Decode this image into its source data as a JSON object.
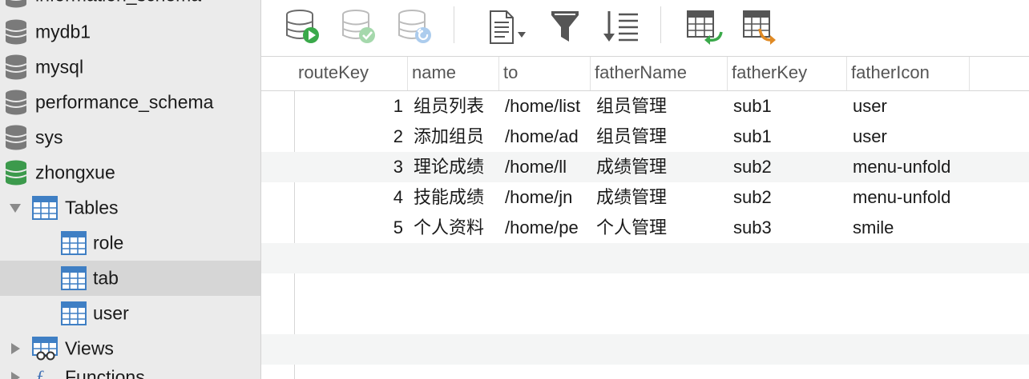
{
  "sidebar": {
    "items": [
      {
        "label": "information_schema",
        "kind": "database",
        "color": "#7a7a7a"
      },
      {
        "label": "mydb1",
        "kind": "database",
        "color": "#7a7a7a"
      },
      {
        "label": "mysql",
        "kind": "database",
        "color": "#7a7a7a"
      },
      {
        "label": "performance_schema",
        "kind": "database",
        "color": "#7a7a7a"
      },
      {
        "label": "sys",
        "kind": "database",
        "color": "#7a7a7a"
      },
      {
        "label": "zhongxue",
        "kind": "database",
        "color": "#3c9a4c"
      },
      {
        "label": "Tables",
        "kind": "group",
        "expanded": true
      },
      {
        "label": "role",
        "kind": "table"
      },
      {
        "label": "tab",
        "kind": "table",
        "selected": true
      },
      {
        "label": "user",
        "kind": "table"
      },
      {
        "label": "Views",
        "kind": "group",
        "expanded": false
      },
      {
        "label": "Functions",
        "kind": "group",
        "expanded": false
      }
    ]
  },
  "toolbar": {
    "buttons": [
      {
        "name": "run-query-button",
        "icon": "database-run-icon",
        "enabled": true
      },
      {
        "name": "apply-button",
        "icon": "database-check-icon",
        "enabled": false
      },
      {
        "name": "discard-button",
        "icon": "database-revert-icon",
        "enabled": false
      },
      {
        "name": "export-menu-button",
        "icon": "document-dropdown-icon",
        "enabled": true
      },
      {
        "name": "filter-button",
        "icon": "filter-icon",
        "enabled": true
      },
      {
        "name": "sort-button",
        "icon": "sort-icon",
        "enabled": true
      },
      {
        "name": "import-button",
        "icon": "table-import-icon",
        "enabled": true
      },
      {
        "name": "export-button",
        "icon": "table-export-icon",
        "enabled": true
      }
    ]
  },
  "grid": {
    "columns": [
      "routeKey",
      "name",
      "to",
      "fatherName",
      "fatherKey",
      "fatherIcon"
    ],
    "rows": [
      [
        "1",
        "组员列表",
        "/home/list",
        "组员管理",
        "sub1",
        "user"
      ],
      [
        "2",
        "添加组员",
        "/home/ad",
        "组员管理",
        "sub1",
        "user"
      ],
      [
        "3",
        "理论成绩",
        "/home/ll",
        "成绩管理",
        "sub2",
        "menu-unfold"
      ],
      [
        "4",
        "技能成绩",
        "/home/jn",
        "成绩管理",
        "sub2",
        "menu-unfold"
      ],
      [
        "5",
        "个人资料",
        "/home/pe",
        "个人管理",
        "sub3",
        "smile"
      ]
    ]
  }
}
